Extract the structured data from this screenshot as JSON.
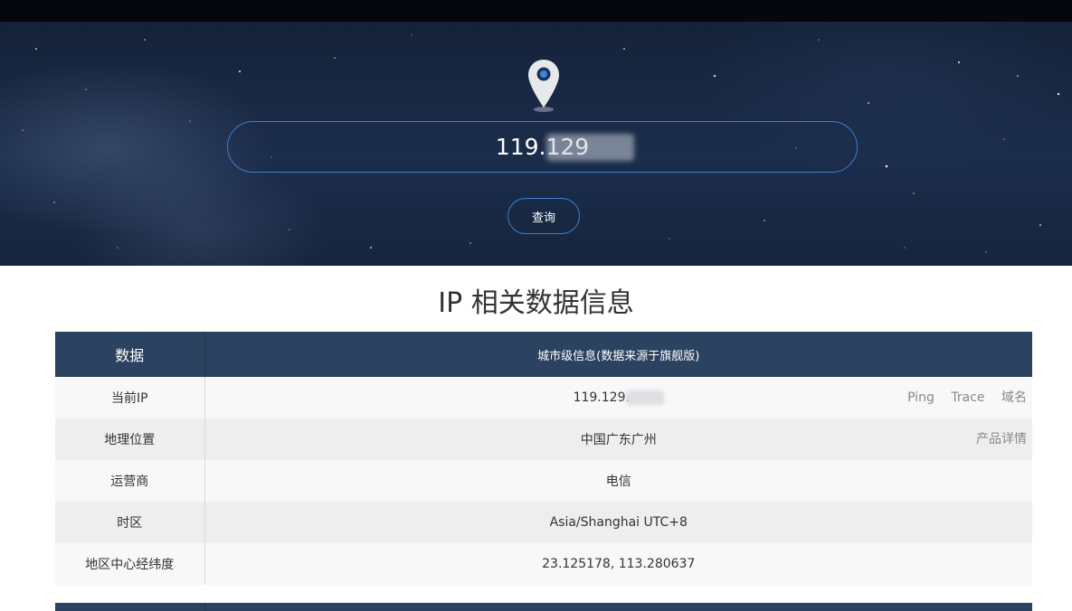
{
  "search": {
    "ip_value": "119.129",
    "button_label": "查询"
  },
  "section": {
    "title": "IP 相关数据信息"
  },
  "table": {
    "header": [
      "数据",
      "城市级信息(数据来源于旗舰版)"
    ],
    "rows": [
      {
        "label": "当前IP",
        "value": "119.129.",
        "links": [
          "Ping",
          "Trace",
          "域名"
        ]
      },
      {
        "label": "地理位置",
        "value": "中国广东广州",
        "links": [
          "产品详情"
        ]
      },
      {
        "label": "运营商",
        "value": "电信",
        "links": []
      },
      {
        "label": "时区",
        "value": "Asia/Shanghai UTC+8",
        "links": []
      },
      {
        "label": "地区中心经纬度",
        "value": "23.125178, 113.280637",
        "links": []
      }
    ]
  },
  "colors": {
    "header_bg": "#2b4260",
    "accent_border": "#3a7fd0",
    "pin_dot": "#2e6fd6"
  },
  "icons": {
    "pin": "location-pin-icon"
  }
}
